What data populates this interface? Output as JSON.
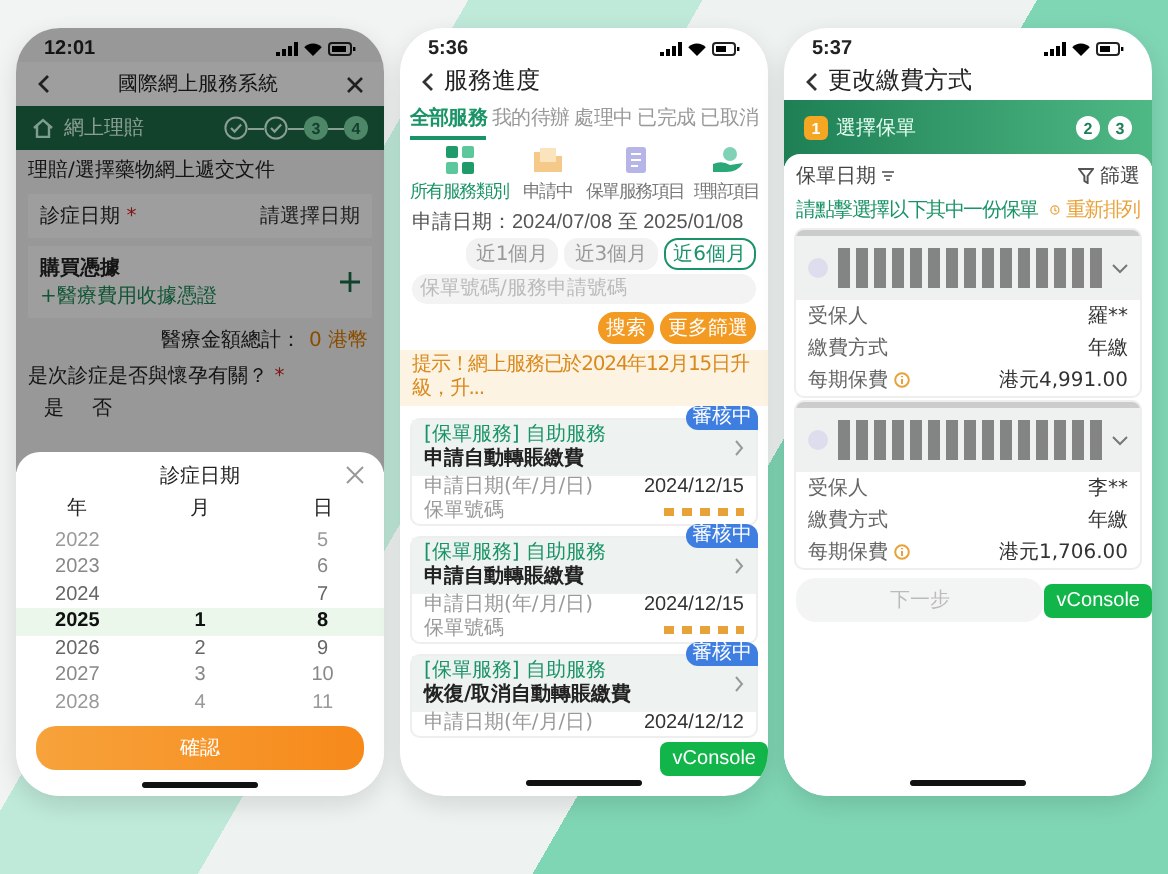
{
  "claim_screen": {
    "status_time": "12:01",
    "title": "國際網上服務系統",
    "banner_label": "網上理賠",
    "steps": [
      {
        "done": true
      },
      {
        "done": true
      },
      {
        "done": false,
        "label": "3"
      },
      {
        "done": false,
        "label": "4"
      }
    ],
    "breadcrumb": "理賠/選擇藥物網上遞交文件",
    "date_field": {
      "label": "診症日期",
      "required": "*",
      "placeholder": "請選擇日期"
    },
    "receipt": {
      "title": "購買憑據",
      "hint": "+醫療費用收據憑證"
    },
    "total": {
      "label": "醫療金額總計：",
      "value": "0 港幣"
    },
    "question": {
      "label": "是次診症是否與懷孕有關？",
      "required": "*",
      "options": [
        "是",
        "否"
      ]
    },
    "picker": {
      "title": "診症日期",
      "columns": [
        "年",
        "月",
        "日"
      ],
      "rows": [
        {
          "year": "2022",
          "day": "5",
          "selected": false
        },
        {
          "year": "2023",
          "day": "6",
          "selected": false
        },
        {
          "year": "2024",
          "day": "7",
          "selected": false
        },
        {
          "year": "2025",
          "month": "1",
          "day": "8",
          "selected": true
        },
        {
          "year": "2026",
          "month": "2",
          "day": "9",
          "selected": false
        },
        {
          "year": "2027",
          "month": "3",
          "day": "10",
          "selected": false
        },
        {
          "year": "2028",
          "month": "4",
          "day": "11",
          "selected": false
        }
      ],
      "confirm": "確認"
    }
  },
  "progress_screen": {
    "status_time": "5:36",
    "title": "服務進度",
    "tabs": [
      {
        "label": "全部服務",
        "selected": true
      },
      {
        "label": "我的待辦",
        "selected": false
      },
      {
        "label": "處理中",
        "selected": false
      },
      {
        "label": "已完成",
        "selected": false
      },
      {
        "label": "已取消",
        "selected": false
      }
    ],
    "categories": [
      {
        "label": "所有服務類別",
        "kind": "grid",
        "selected": true
      },
      {
        "label": "申請中",
        "kind": "folder",
        "selected": false
      },
      {
        "label": "保單服務項目",
        "kind": "document",
        "selected": false
      },
      {
        "label": "理賠項目",
        "kind": "hand",
        "selected": false
      }
    ],
    "date_range": "申請日期：2024/07/08 至 2025/01/08",
    "periods": [
      {
        "label": "近1個月",
        "selected": false
      },
      {
        "label": "近3個月",
        "selected": false
      },
      {
        "label": "近6個月",
        "selected": true
      }
    ],
    "search": {
      "placeholder": "保單號碼/服務申請號碼"
    },
    "search_button": "搜索",
    "filter_button": "更多篩選",
    "notice": "提示！網上服務已於2024年12月15日升級，升...",
    "cards": [
      {
        "status": "審核中",
        "category": "[保單服務] 自助服務",
        "title": "申請自動轉賬繳費",
        "date_label": "申請日期(年/月/日)",
        "date": "2024/12/15",
        "policy_label": "保單號碼"
      },
      {
        "status": "審核中",
        "category": "[保單服務] 自助服務",
        "title": "申請自動轉賬繳費",
        "date_label": "申請日期(年/月/日)",
        "date": "2024/12/15",
        "policy_label": "保單號碼"
      },
      {
        "status": "審核中",
        "category": "[保單服務] 自助服務",
        "title": "恢復/取消自動轉賬繳費",
        "date_label": "申請日期(年/月/日)",
        "date": "2024/12/12"
      }
    ],
    "console_badge": "vConsole"
  },
  "payment_screen": {
    "status_time": "5:37",
    "title": "更改繳費方式",
    "steps": [
      {
        "label": "1",
        "caption": "選擇保單",
        "selected": true
      },
      {
        "label": "2",
        "selected": false
      },
      {
        "label": "3",
        "selected": false
      }
    ],
    "sort_label": "保單日期",
    "filter_label": "篩選",
    "instruction": "請點擊選擇以下其中一份保單",
    "reset_label": "重新排列",
    "policies": [
      {
        "rows": [
          {
            "label": "受保人",
            "value": "羅**",
            "info": false
          },
          {
            "label": "繳費方式",
            "value": "年繳",
            "info": false
          },
          {
            "label": "每期保費",
            "value": "港元4,991.00",
            "info": true
          }
        ]
      },
      {
        "rows": [
          {
            "label": "受保人",
            "value": "李**",
            "info": false
          },
          {
            "label": "繳費方式",
            "value": "年繳",
            "info": false
          },
          {
            "label": "每期保費",
            "value": "港元1,706.00",
            "info": true
          }
        ]
      }
    ],
    "next_button": {
      "label": "下一步",
      "disabled": true
    },
    "console_badge": "vConsole"
  }
}
